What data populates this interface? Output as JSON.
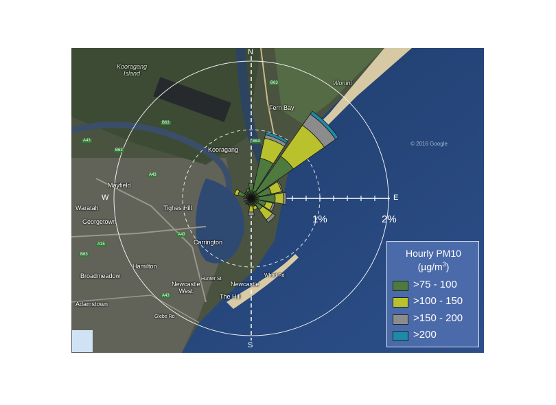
{
  "map": {
    "compass": {
      "north": "N",
      "east": "E",
      "south": "S",
      "west": "W"
    },
    "rings": [
      "1%",
      "2%"
    ],
    "places": [
      {
        "name": "Kooragang\nIsland",
        "key": "kooragang_island"
      },
      {
        "name": "Wonini",
        "key": "wonini"
      },
      {
        "name": "Fern Bay",
        "key": "fern_bay"
      },
      {
        "name": "Kooragang",
        "key": "kooragang"
      },
      {
        "name": "Mayfield",
        "key": "mayfield"
      },
      {
        "name": "Waratah",
        "key": "waratah"
      },
      {
        "name": "Georgetown",
        "key": "georgetown"
      },
      {
        "name": "Tighes Hill",
        "key": "tighes_hill"
      },
      {
        "name": "Carrington",
        "key": "carrington"
      },
      {
        "name": "Hamilton",
        "key": "hamilton"
      },
      {
        "name": "Broadmeadow",
        "key": "broadmeadow"
      },
      {
        "name": "Newcastle\nWest",
        "key": "newcastle_west"
      },
      {
        "name": "Newcastle",
        "key": "newcastle"
      },
      {
        "name": "The Hill",
        "key": "the_hill"
      },
      {
        "name": "Adamstown",
        "key": "adamstown"
      },
      {
        "name": "Wharf Rd",
        "key": "wharf_rd"
      },
      {
        "name": "Hunter St",
        "key": "hunter_st"
      },
      {
        "name": "Glebe Rd",
        "key": "glebe_rd"
      }
    ],
    "roads": [
      "B63",
      "B63",
      "B63",
      "B63",
      "A43",
      "A43",
      "A43",
      "A15",
      "B63",
      "A43"
    ],
    "copyright": "© 2016 Google"
  },
  "legend": {
    "title_line1": "Hourly PM10",
    "title_line2": "(µg/m",
    "title_sup": "3",
    "title_close": ")",
    "items": [
      {
        "label": ">75 - 100",
        "color": "#4f7a3e"
      },
      {
        "label": ">100 - 150",
        "color": "#b9c12d"
      },
      {
        "label": ">150 - 200",
        "color": "#8c8c8c"
      },
      {
        "label": ">200",
        "color": "#1f8aa8"
      }
    ]
  },
  "windrose": {
    "sectors": [
      {
        "dir": 0,
        "bins": [
          0.22,
          0.0,
          0.0,
          0.0
        ]
      },
      {
        "dir": 22.5,
        "bins": [
          0.6,
          0.3,
          0.05,
          0.04
        ]
      },
      {
        "dir": 45,
        "bins": [
          0.75,
          0.55,
          0.2,
          0.05
        ]
      },
      {
        "dir": 67.5,
        "bins": [
          0.3,
          0.15,
          0.02,
          0.0
        ]
      },
      {
        "dir": 90,
        "bins": [
          0.35,
          0.12,
          0.04,
          0.0
        ]
      },
      {
        "dir": 112.5,
        "bins": [
          0.22,
          0.1,
          0.03,
          0.0
        ]
      },
      {
        "dir": 135,
        "bins": [
          0.2,
          0.18,
          0.05,
          0.0
        ]
      },
      {
        "dir": 157.5,
        "bins": [
          0.12,
          0.05,
          0.0,
          0.0
        ]
      },
      {
        "dir": 180,
        "bins": [
          0.1,
          0.1,
          0.05,
          0.0
        ]
      },
      {
        "dir": 202.5,
        "bins": [
          0.1,
          0.0,
          0.0,
          0.0
        ]
      },
      {
        "dir": 225,
        "bins": [
          0.1,
          0.0,
          0.0,
          0.0
        ]
      },
      {
        "dir": 247.5,
        "bins": [
          0.05,
          0.0,
          0.0,
          0.0
        ]
      },
      {
        "dir": 270,
        "bins": [
          0.06,
          0.0,
          0.0,
          0.0
        ]
      },
      {
        "dir": 292.5,
        "bins": [
          0.2,
          0.05,
          0.0,
          0.0
        ]
      },
      {
        "dir": 315,
        "bins": [
          0.12,
          0.0,
          0.0,
          0.0
        ]
      },
      {
        "dir": 337.5,
        "bins": [
          0.15,
          0.0,
          0.0,
          0.0
        ]
      }
    ]
  }
}
